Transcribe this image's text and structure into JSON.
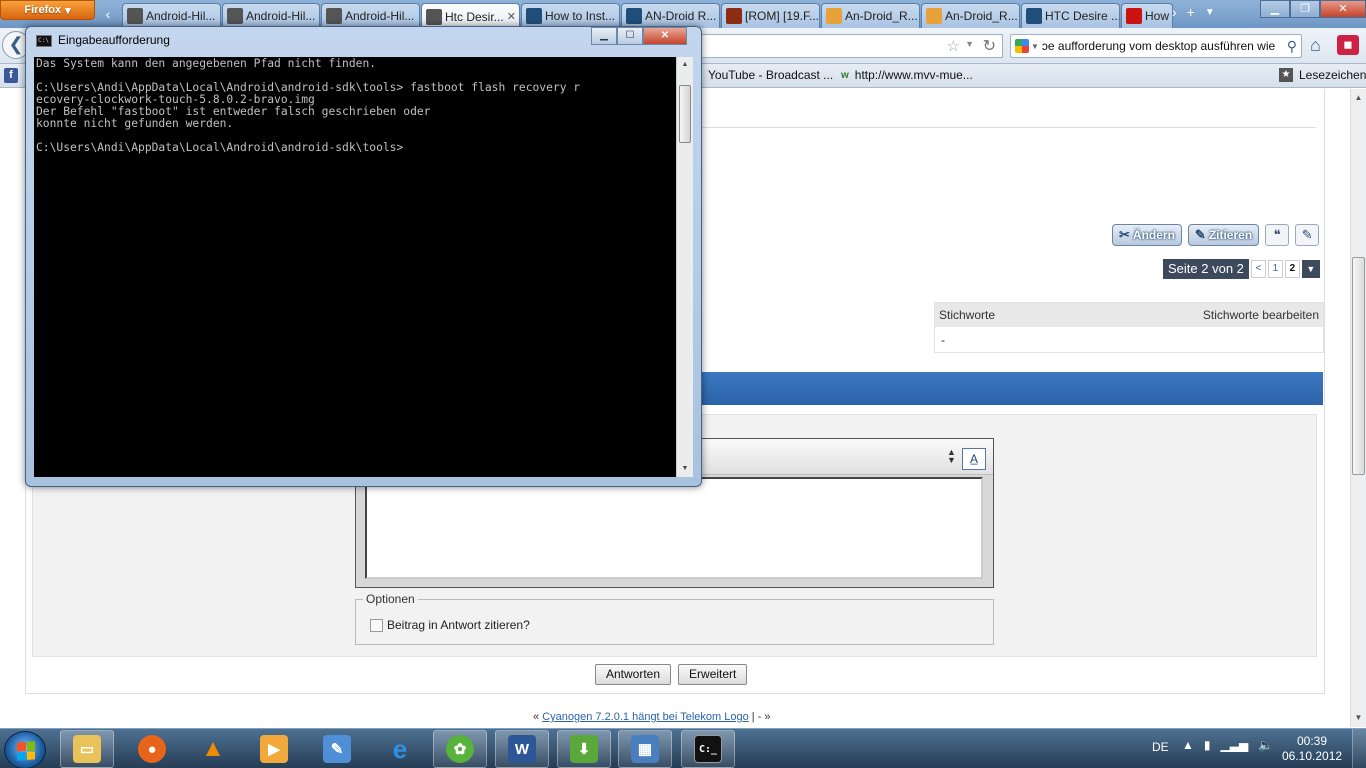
{
  "browser": {
    "menu_button": "Firefox",
    "tabs": [
      {
        "label": "Android-Hil...",
        "icon": "android-icon",
        "color": "#555555"
      },
      {
        "label": "Android-Hil...",
        "icon": "android-icon",
        "color": "#555555"
      },
      {
        "label": "Android-Hil...",
        "icon": "android-icon",
        "color": "#555555"
      },
      {
        "label": "Htc Desir...",
        "icon": "android-icon",
        "color": "#555555",
        "active": true
      },
      {
        "label": "How to Inst...",
        "icon": "un-icon",
        "color": "#1f4e79"
      },
      {
        "label": "AN-Droid R...",
        "icon": "un-icon",
        "color": "#1f4e79"
      },
      {
        "label": "[ROM] [19.F...",
        "icon": "xda-icon",
        "color": "#8b2d12"
      },
      {
        "label": "An-Droid_R...",
        "icon": "m-icon",
        "color": "#e8a23a"
      },
      {
        "label": "An-Droid_R...",
        "icon": "m-icon",
        "color": "#e8a23a"
      },
      {
        "label": "HTC Desire ...",
        "icon": "un-icon",
        "color": "#1f4e79"
      },
      {
        "label": "How",
        "icon": "youtube-icon",
        "color": "#cc1111"
      }
    ],
    "search_text": "ɔe aufforderung vom desktop ausführen wie",
    "bookmarks": [
      {
        "label": "YouTube - Broadcast ..."
      },
      {
        "label": "http://www.mvv-mue..."
      }
    ],
    "bookmarks_menu": "Lesezeichen"
  },
  "forum": {
    "buttons": {
      "edit": "Ändern",
      "quote": "Zitieren"
    },
    "pagination": {
      "label": "Seite 2 von 2",
      "prev": "<",
      "pages": [
        "1",
        "2"
      ],
      "current": "2"
    },
    "tags": {
      "header": "Stichworte",
      "edit_link": "Stichworte bearbeiten",
      "value": "-"
    },
    "options": {
      "legend": "Optionen",
      "quote_checkbox": "Beitrag in Antwort zitieren?"
    },
    "actions": {
      "reply": "Antworten",
      "advanced": "Erweitert"
    },
    "thread_nav": {
      "prev_marker": "«",
      "link": "Cyanogen 7.2.0.1 hängt bei Telekom Logo",
      "sep": "| -",
      "next_marker": "»"
    }
  },
  "console": {
    "title": "Eingabeaufforderung",
    "lines": [
      "Das System kann den angegebenen Pfad nicht finden.",
      "",
      "C:\\Users\\Andi\\AppData\\Local\\Android\\android-sdk\\tools> fastboot flash recovery r",
      "ecovery-clockwork-touch-5.8.0.2-bravo.img",
      "Der Befehl \"fastboot\" ist entweder falsch geschrieben oder",
      "konnte nicht gefunden werden.",
      "",
      "C:\\Users\\Andi\\AppData\\Local\\Android\\android-sdk\\tools>"
    ]
  },
  "taskbar": {
    "apps": [
      {
        "name": "explorer-icon",
        "color": "#e9c25a"
      },
      {
        "name": "firefox-icon",
        "color": "#e8641b"
      },
      {
        "name": "vlc-icon",
        "color": "#f08a00"
      },
      {
        "name": "media-player-icon",
        "color": "#f2a93b"
      },
      {
        "name": "paint-icon",
        "color": "#4f8fd8"
      },
      {
        "name": "internet-explorer-icon",
        "color": "#2f8fe0"
      },
      {
        "name": "icq-icon",
        "color": "#57b33a"
      },
      {
        "name": "word-icon",
        "color": "#2b5797"
      },
      {
        "name": "download-icon",
        "color": "#5aa83a"
      },
      {
        "name": "control-panel-icon",
        "color": "#4a7fbf"
      },
      {
        "name": "cmd-icon",
        "color": "#111111"
      }
    ],
    "language": "DE",
    "time": "00:39",
    "date": "06.10.2012"
  }
}
